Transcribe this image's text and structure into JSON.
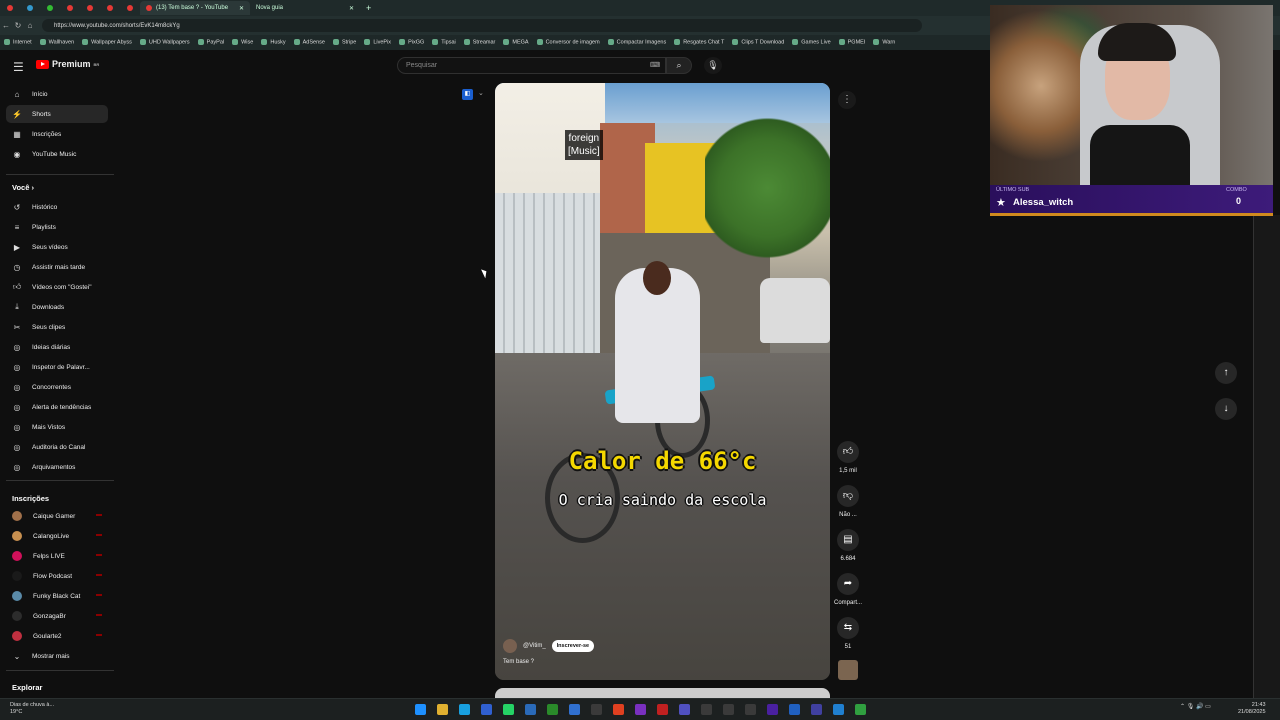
{
  "browser": {
    "tabs": [
      {
        "label": "(13) Tem base ? - YouTube",
        "active": true
      },
      {
        "label": "Nova guia",
        "active": false
      }
    ],
    "url": "https://www.youtube.com/shorts/EvK14m8ckYg",
    "bookmarks": [
      "Internet",
      "Wallhaven",
      "Wallpaper Abyss",
      "UHD Wallpapers",
      "PayPal",
      "Wise",
      "Husky",
      "AdSense",
      "Stripe",
      "LivePix",
      "PixGG",
      "Tipsai",
      "Streamar",
      "MEGA",
      "Conversor de imagem",
      "Compactar Imagens",
      "Resgates Chat T",
      "Clips T Download",
      "Games Live",
      "PGMEI",
      "Warn"
    ]
  },
  "youtube": {
    "logo_text": "Premium",
    "logo_region": "BR",
    "search_placeholder": "Pesquisar",
    "nav": [
      {
        "label": "Início",
        "icon": "home-icon"
      },
      {
        "label": "Shorts",
        "icon": "shorts-icon",
        "selected": true
      },
      {
        "label": "Inscrições",
        "icon": "subscriptions-icon"
      },
      {
        "label": "YouTube Music",
        "icon": "music-icon"
      }
    ],
    "you_section": "Você",
    "you_items": [
      {
        "label": "Histórico",
        "icon": "history-icon"
      },
      {
        "label": "Playlists",
        "icon": "playlist-icon"
      },
      {
        "label": "Seus vídeos",
        "icon": "video-icon"
      },
      {
        "label": "Assistir mais tarde",
        "icon": "clock-icon"
      },
      {
        "label": "Vídeos com \"Gostei\"",
        "icon": "like-icon"
      },
      {
        "label": "Downloads",
        "icon": "download-icon"
      },
      {
        "label": "Seus clipes",
        "icon": "scissors-icon"
      },
      {
        "label": "Ideias diárias",
        "icon": "extension-icon"
      },
      {
        "label": "Inspetor de Palavr...",
        "icon": "extension-icon"
      },
      {
        "label": "Concorrentes",
        "icon": "extension-icon"
      },
      {
        "label": "Alerta de tendências",
        "icon": "extension-icon"
      },
      {
        "label": "Mais Vistos",
        "icon": "extension-icon"
      },
      {
        "label": "Auditoria do Canal",
        "icon": "extension-icon"
      },
      {
        "label": "Arquivamentos",
        "icon": "extension-icon"
      }
    ],
    "subs_section": "Inscrições",
    "subs": [
      {
        "label": "Caique Gamer",
        "color": "#a0704a"
      },
      {
        "label": "CalangoLive",
        "color": "#c89050"
      },
      {
        "label": "Felps LIVE",
        "color": "#d0105a"
      },
      {
        "label": "Flow Podcast",
        "color": "#1a1a1a"
      },
      {
        "label": "Funky Black Cat",
        "color": "#5a8aa8"
      },
      {
        "label": "GonzagaBr",
        "color": "#2c2c2c"
      },
      {
        "label": "Goularte2",
        "color": "#c03040"
      }
    ],
    "show_more": "Mostrar mais",
    "explore": "Explorar"
  },
  "short": {
    "caption_top": "foreign\n[Music]",
    "caption_big": "Calor de 66°c",
    "caption_sub": "O cria saindo da escola",
    "channel": "@Vitim_",
    "subscribe": "Inscrever-se",
    "title": "Tem base ?",
    "likes": "1,5 mil",
    "dislike": "Não ...",
    "comments": "6.684",
    "share": "Compart...",
    "remix": "51"
  },
  "webcam": {
    "label_left": "ÚLTIMO SUB",
    "label_right": "COMBO",
    "name": "Alessa_witch",
    "combo": "0"
  },
  "taskbar": {
    "weather": "Dias de chuva à...",
    "temp": "19°C",
    "time": "21:43",
    "date": "21/08/2025"
  }
}
